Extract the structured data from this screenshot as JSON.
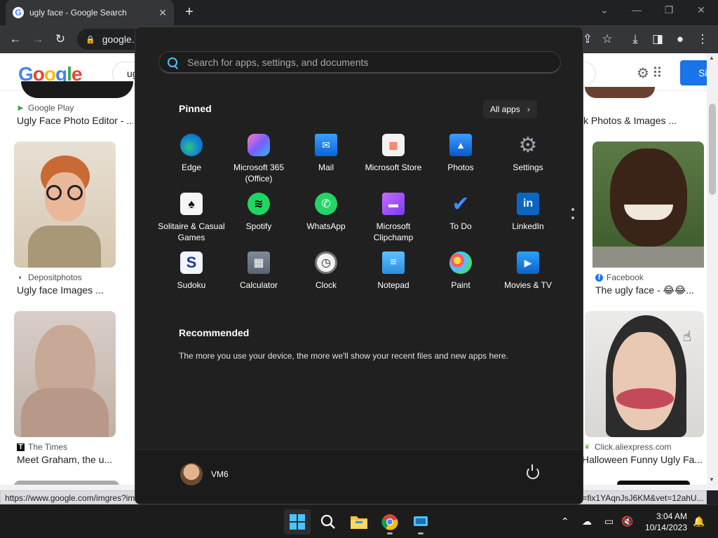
{
  "browser": {
    "tab_title": "ugly face - Google Search",
    "address": "google.c",
    "status_url": "https://www.google.com/imgres?imgurl=https%3A%2F%2Fthemamerican.net%2Fwp-content%2Fuploads%2F2023%2F08%2Fugly-face-meme-4.jpg&tbnid=fix1YAqnJsJ6KM&vet=12ahU..."
  },
  "google": {
    "logo": "Google",
    "query": "ug",
    "signin_label": "Si",
    "results": [
      {
        "source": "Google Play",
        "caption": "Ugly Face Photo Editor - ..."
      },
      {
        "source": "Depositphotos",
        "caption": "Ugly face Images ..."
      },
      {
        "source": "The Times",
        "caption": "Meet Graham, the u..."
      },
      {
        "source": "",
        "caption": "k Photos & Images ..."
      },
      {
        "source": "Facebook",
        "caption": "The ugly face - 😂😂..."
      },
      {
        "source": "Click.aliexpress.com",
        "caption": "Halloween Funny Ugly Fa..."
      }
    ]
  },
  "start_menu": {
    "search_placeholder": "Search for apps, settings, and documents",
    "pinned_heading": "Pinned",
    "all_apps_label": "All apps",
    "recommended_heading": "Recommended",
    "recommended_text": "The more you use your device, the more we'll show your recent files and new apps here.",
    "user_name": "VM6",
    "apps": [
      {
        "label": "Edge"
      },
      {
        "label": "Microsoft 365 (Office)"
      },
      {
        "label": "Mail"
      },
      {
        "label": "Microsoft Store"
      },
      {
        "label": "Photos"
      },
      {
        "label": "Settings"
      },
      {
        "label": "Solitaire & Casual Games"
      },
      {
        "label": "Spotify"
      },
      {
        "label": "WhatsApp"
      },
      {
        "label": "Microsoft Clipchamp"
      },
      {
        "label": "To Do"
      },
      {
        "label": "LinkedIn"
      },
      {
        "label": "Sudoku"
      },
      {
        "label": "Calculator"
      },
      {
        "label": "Clock"
      },
      {
        "label": "Notepad"
      },
      {
        "label": "Paint"
      },
      {
        "label": "Movies & TV"
      }
    ]
  },
  "taskbar": {
    "time": "3:04 AM",
    "date": "10/14/2023"
  },
  "colors": {
    "accent": "#4cc2ff",
    "start_bg": "#202020",
    "google_blue": "#1a73e8"
  }
}
